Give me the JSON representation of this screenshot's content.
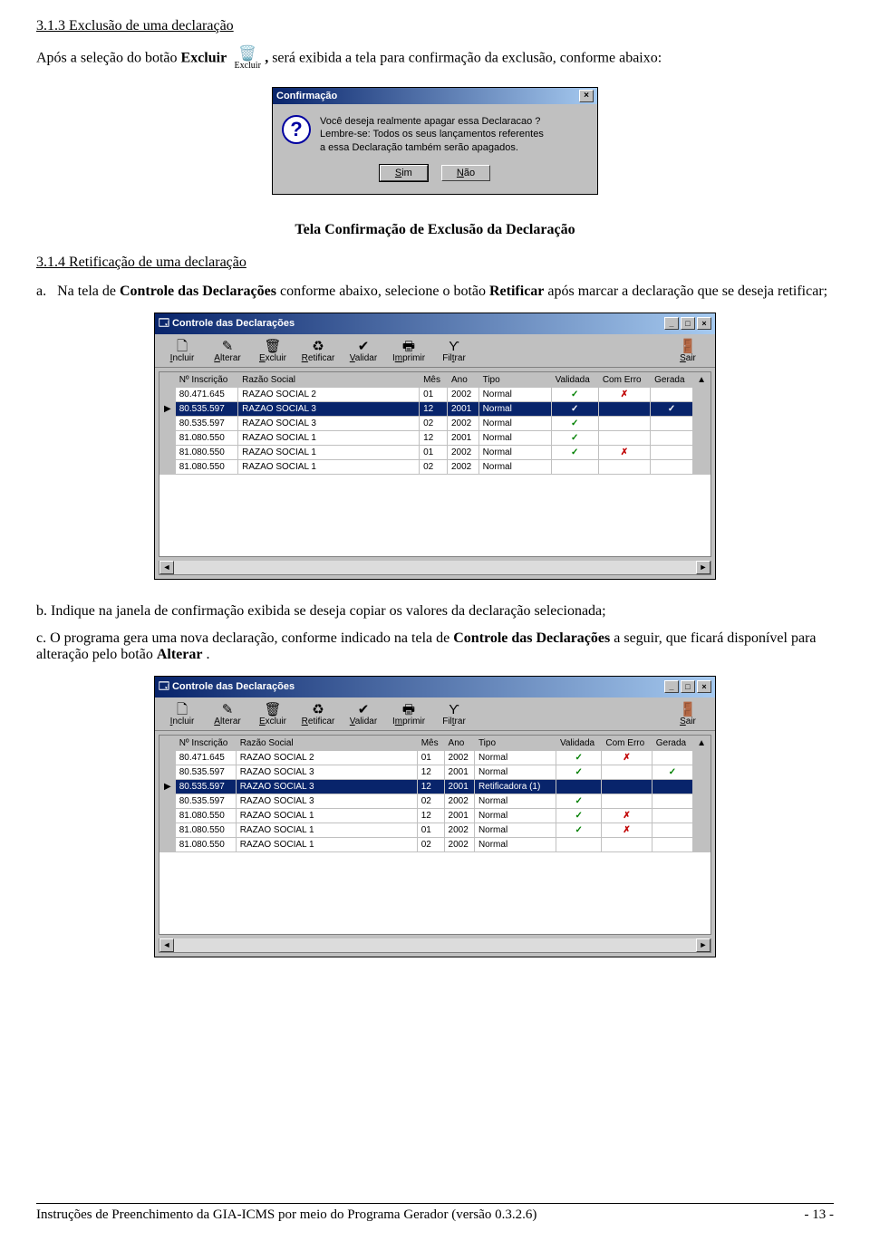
{
  "section313_title": "3.1.3 Exclusão de uma declaração",
  "intro_para_before": "Após a seleção do botão ",
  "intro_bold": "Excluir",
  "inline_icon_label": "Excluir",
  "intro_bold_comma": ",",
  "intro_para_after": " será exibida a tela para confirmação da exclusão, conforme abaixo:",
  "dialog": {
    "title": "Confirmação",
    "msg_l1": "Você deseja realmente apagar essa Declaracao ?",
    "msg_l2": "Lembre-se: Todos os seus lançamentos referentes",
    "msg_l3": "a essa Declaração também serão apagados.",
    "btn_yes_u": "S",
    "btn_yes_rest": "im",
    "btn_no_u": "N",
    "btn_no_rest": "ão"
  },
  "caption1": "Tela Confirmação de Exclusão da Declaração",
  "section314_title": "3.1.4 Retificação de uma declaração",
  "item_a_prefix": "a.",
  "item_a_before": "Na tela de ",
  "item_a_bold1": "Controle das Declarações",
  "item_a_mid": " conforme abaixo, selecione o botão ",
  "item_a_bold2": "Retificar",
  "item_a_after": " após marcar a declaração que se deseja retificar;",
  "item_b_prefix": "b.",
  "item_b_text": " Indique na janela de confirmação exibida se deseja copiar os valores da declaração selecionada;",
  "item_c_prefix": "c.",
  "item_c_before": " O programa gera uma nova declaração, conforme indicado na tela de ",
  "item_c_bold": "Controle das Declarações",
  "item_c_mid": " a seguir, que ficará disponível para alteração pelo botão ",
  "item_c_bold2": "Alterar",
  "item_c_after": ".",
  "win": {
    "title": "Controle das Declarações",
    "toolbar": {
      "incluir": "Incluir",
      "alterar": "Alterar",
      "excluir": "Excluir",
      "retificar": "Retificar",
      "validar": "Validar",
      "imprimir": "Imprimir",
      "filtrar": "Filtrar",
      "sair": "Sair"
    },
    "cols": {
      "insc": "Nº Inscrição",
      "razao": "Razão Social",
      "mes": "Mês",
      "ano": "Ano",
      "tipo": "Tipo",
      "validada": "Validada",
      "comerro": "Com Erro",
      "gerada": "Gerada"
    },
    "rows1": [
      {
        "insc": "80.471.645",
        "razao": "RAZAO SOCIAL 2",
        "mes": "01",
        "ano": "2002",
        "tipo": "Normal",
        "val": "✓",
        "err": "✗",
        "ger": ""
      },
      {
        "insc": "80.535.597",
        "razao": "RAZAO SOCIAL 3",
        "mes": "12",
        "ano": "2001",
        "tipo": "Normal",
        "val": "✓",
        "err": "",
        "ger": "✓",
        "sel": true,
        "mark": "▶"
      },
      {
        "insc": "80.535.597",
        "razao": "RAZAO SOCIAL 3",
        "mes": "02",
        "ano": "2002",
        "tipo": "Normal",
        "val": "✓",
        "err": "",
        "ger": ""
      },
      {
        "insc": "81.080.550",
        "razao": "RAZAO SOCIAL 1",
        "mes": "12",
        "ano": "2001",
        "tipo": "Normal",
        "val": "✓",
        "err": "",
        "ger": ""
      },
      {
        "insc": "81.080.550",
        "razao": "RAZAO SOCIAL 1",
        "mes": "01",
        "ano": "2002",
        "tipo": "Normal",
        "val": "✓",
        "err": "✗",
        "ger": ""
      },
      {
        "insc": "81.080.550",
        "razao": "RAZAO SOCIAL 1",
        "mes": "02",
        "ano": "2002",
        "tipo": "Normal",
        "val": "",
        "err": "",
        "ger": ""
      }
    ],
    "rows2": [
      {
        "insc": "80.471.645",
        "razao": "RAZAO SOCIAL 2",
        "mes": "01",
        "ano": "2002",
        "tipo": "Normal",
        "val": "✓",
        "err": "✗",
        "ger": ""
      },
      {
        "insc": "80.535.597",
        "razao": "RAZAO SOCIAL 3",
        "mes": "12",
        "ano": "2001",
        "tipo": "Normal",
        "val": "✓",
        "err": "",
        "ger": "✓"
      },
      {
        "insc": "80.535.597",
        "razao": "RAZAO SOCIAL 3",
        "mes": "12",
        "ano": "2001",
        "tipo": "Retificadora (1)",
        "val": "",
        "err": "",
        "ger": "",
        "sel": true,
        "mark": "▶"
      },
      {
        "insc": "80.535.597",
        "razao": "RAZAO SOCIAL 3",
        "mes": "02",
        "ano": "2002",
        "tipo": "Normal",
        "val": "✓",
        "err": "",
        "ger": ""
      },
      {
        "insc": "81.080.550",
        "razao": "RAZAO SOCIAL 1",
        "mes": "12",
        "ano": "2001",
        "tipo": "Normal",
        "val": "✓",
        "err": "✗",
        "ger": ""
      },
      {
        "insc": "81.080.550",
        "razao": "RAZAO SOCIAL 1",
        "mes": "01",
        "ano": "2002",
        "tipo": "Normal",
        "val": "✓",
        "err": "✗",
        "ger": ""
      },
      {
        "insc": "81.080.550",
        "razao": "RAZAO SOCIAL 1",
        "mes": "02",
        "ano": "2002",
        "tipo": "Normal",
        "val": "",
        "err": "",
        "ger": ""
      }
    ]
  },
  "footer_left": "Instruções de Preenchimento da GIA-ICMS por meio do Programa Gerador (versão 0.3.2.6)",
  "footer_right": "- 13 -"
}
